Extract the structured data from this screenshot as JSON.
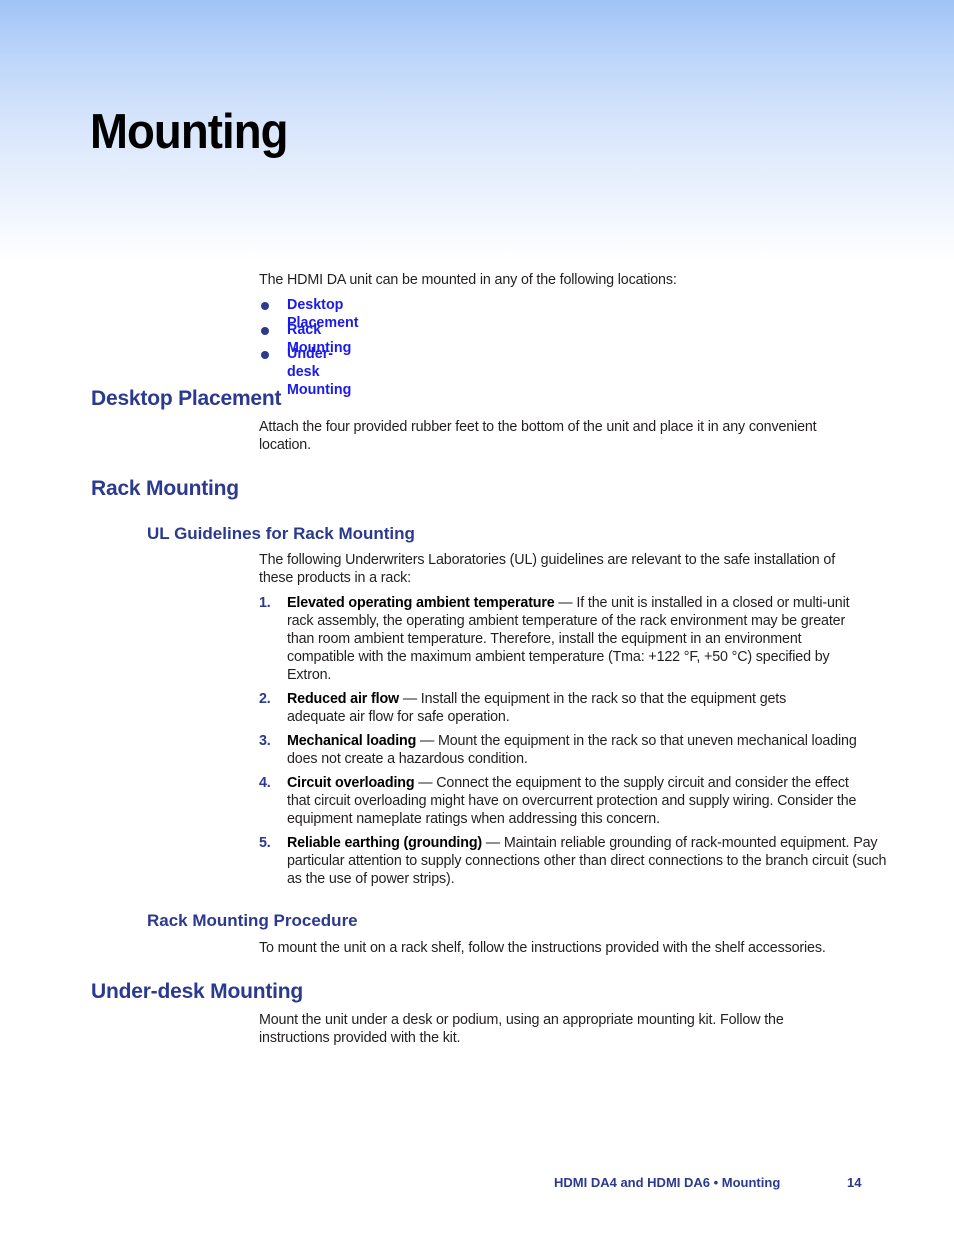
{
  "page": {
    "title": "Mounting",
    "intro": "The HDMI DA unit can be mounted in any of the following locations:",
    "toc_links": [
      {
        "label": "Desktop Placement"
      },
      {
        "label": "Rack Mounting"
      },
      {
        "label": "Under-desk Mounting"
      }
    ],
    "colors": {
      "heading": "#2b3a8f",
      "link": "#1a1aeb",
      "header_gradient_top": "#a0c3f6",
      "text": "#231f20"
    }
  },
  "sections": {
    "desktop": {
      "heading": "Desktop Placement",
      "text": "Attach the four provided rubber feet to the bottom of the unit and place it in any convenient location."
    },
    "rack": {
      "heading": "Rack Mounting",
      "ul_guidelines": {
        "heading": "UL Guidelines for Rack Mounting",
        "intro": "The following Underwriters Laboratories (UL) guidelines are relevant to the safe installation of these products in a rack:",
        "items": [
          {
            "num": "1.",
            "term": "Elevated operating ambient temperature",
            "dash": " — ",
            "text": "If the unit is installed in a closed or multi-unit rack assembly, the operating ambient temperature of the rack environment may be greater than room ambient temperature.  Therefore, install the equipment in an environment compatible with the maximum ambient temperature (Tma: +122 °F, +50 °C) specified by Extron."
          },
          {
            "num": "2.",
            "term": "Reduced air flow",
            "dash": " — ",
            "text": "Install the equipment in the rack so that the equipment gets adequate air flow for safe operation."
          },
          {
            "num": "3.",
            "term": "Mechanical loading",
            "dash": " — ",
            "text": "Mount the equipment in the rack so that uneven mechanical loading does not create a hazardous condition."
          },
          {
            "num": "4.",
            "term": "Circuit overloading",
            "dash": " — ",
            "text": "Connect the equipment to the supply circuit and consider the effect that circuit overloading might have on overcurrent protection and supply wiring. Consider the equipment nameplate ratings when addressing this concern."
          },
          {
            "num": "5.",
            "term": "Reliable earthing (grounding)",
            "dash": " — ",
            "text": "Maintain reliable grounding of rack-mounted equipment. Pay particular attention to supply connections other than direct connections to the branch circuit (such as the use of power strips)."
          }
        ]
      },
      "procedure": {
        "heading": "Rack Mounting Procedure",
        "text": "To mount the unit on a rack shelf, follow the instructions provided with the shelf accessories."
      }
    },
    "underdesk": {
      "heading": "Under-desk Mounting",
      "text": "Mount the unit under a desk or podium, using an appropriate mounting kit. Follow the instructions provided with the kit."
    }
  },
  "footer": {
    "doc_title": "HDMI DA4 and HDMI DA6 • Mounting",
    "page_number": "14"
  }
}
